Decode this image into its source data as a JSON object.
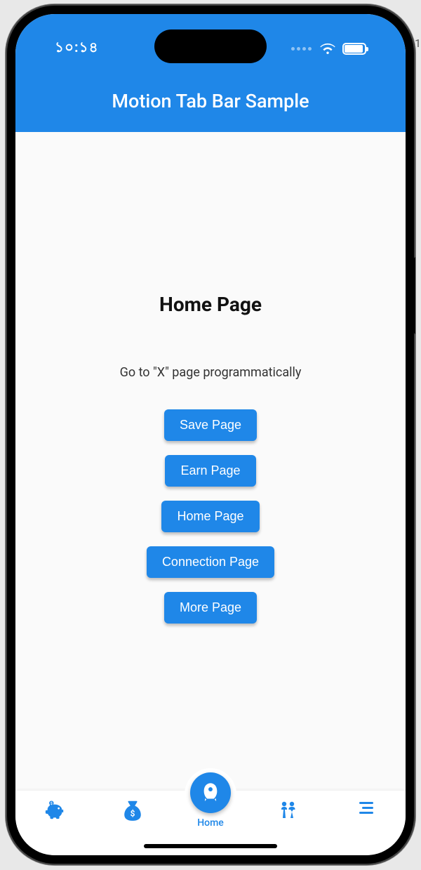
{
  "status": {
    "time": "১০:১৪"
  },
  "header": {
    "title": "Motion Tab Bar Sample"
  },
  "main": {
    "page_title": "Home Page",
    "subtitle": "Go to \"X\" page programmatically",
    "buttons": [
      "Save Page",
      "Earn Page",
      "Home Page",
      "Connection Page",
      "More Page"
    ]
  },
  "tabs": {
    "active_index": 2,
    "active_label": "Home",
    "items": [
      {
        "name": "save",
        "icon": "piggy-bank-icon"
      },
      {
        "name": "earn",
        "icon": "money-bag-icon"
      },
      {
        "name": "home",
        "icon": "rocket-icon",
        "label": "Home"
      },
      {
        "name": "connect",
        "icon": "people-icon"
      },
      {
        "name": "more",
        "icon": "menu-icon"
      }
    ]
  },
  "colors": {
    "primary": "#1f87e8",
    "background": "#fafafa"
  },
  "edge_char": "1"
}
